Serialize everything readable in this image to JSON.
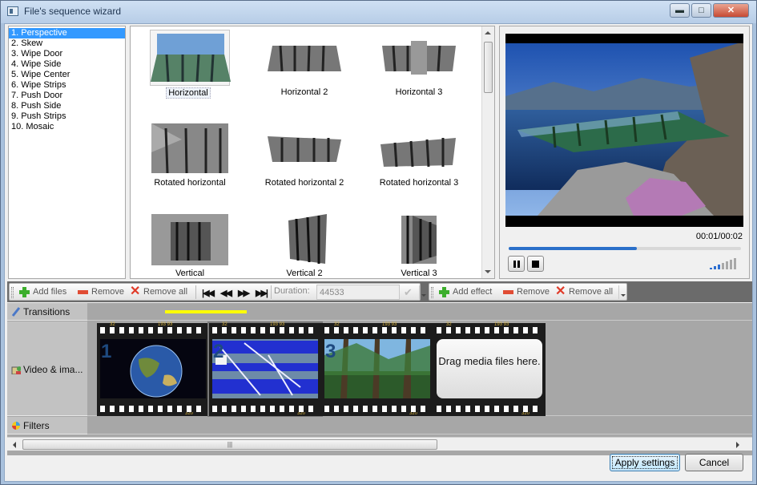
{
  "window": {
    "title": "File's sequence wizard",
    "controls": {
      "minimize": "▬",
      "maximize": "□",
      "close": "✕"
    }
  },
  "effects": [
    "1. Perspective",
    "2. Skew",
    "3. Wipe Door",
    "4. Wipe Side",
    "5. Wipe Center",
    "6. Wipe Strips",
    "7. Push Door",
    "8. Push Side",
    "9. Push Strips",
    "10. Mosaic"
  ],
  "gallery": [
    "Horizontal",
    "Horizontal 2",
    "Horizontal 3",
    "Rotated horizontal",
    "Rotated horizontal 2",
    "Rotated horizontal 3",
    "Vertical",
    "Vertical 2",
    "Vertical 3"
  ],
  "preview": {
    "time": "00:01/00:02",
    "progress": 0.55
  },
  "toolbar_left": {
    "add_files": "Add files",
    "remove": "Remove",
    "remove_all": "Remove all",
    "duration_label": "Duration:",
    "duration_value": "44533"
  },
  "toolbar_right": {
    "add_effect": "Add effect",
    "remove": "Remove",
    "remove_all": "Remove all"
  },
  "timeline": {
    "tracks": {
      "transitions": "Transitions",
      "video": "Video & ima...",
      "filters": "Filters"
    },
    "clips": [
      "1",
      "2",
      "3"
    ],
    "drop_hint": "Drag media files here.",
    "film_marks": {
      "a": "32",
      "b": "193 93",
      "c": "320"
    }
  },
  "footer": {
    "apply": "Apply settings",
    "cancel": "Cancel",
    "scroll_grip": "|||"
  },
  "colors": {
    "selection": "#3399ff",
    "progress": "#2a6fc9",
    "transition_marker": "#ffff00"
  }
}
